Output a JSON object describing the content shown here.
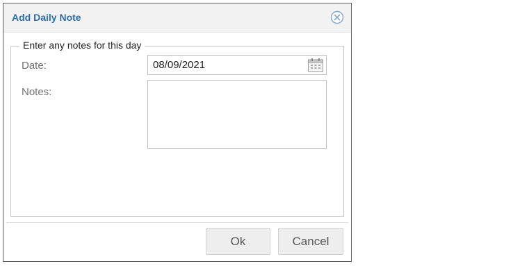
{
  "dialog": {
    "title": "Add Daily Note",
    "close_icon": "close-circle-x-icon"
  },
  "form": {
    "legend": "Enter any notes for this day",
    "date_label": "Date:",
    "date_value": "08/09/2021",
    "calendar_icon": "calendar-icon",
    "notes_label": "Notes:",
    "notes_value": ""
  },
  "footer": {
    "ok_label": "Ok",
    "cancel_label": "Cancel"
  },
  "colors": {
    "title": "#2a6fb5",
    "title_bar": "#f2f2f2",
    "label": "#707070",
    "button_bg": "#eeeeee"
  }
}
